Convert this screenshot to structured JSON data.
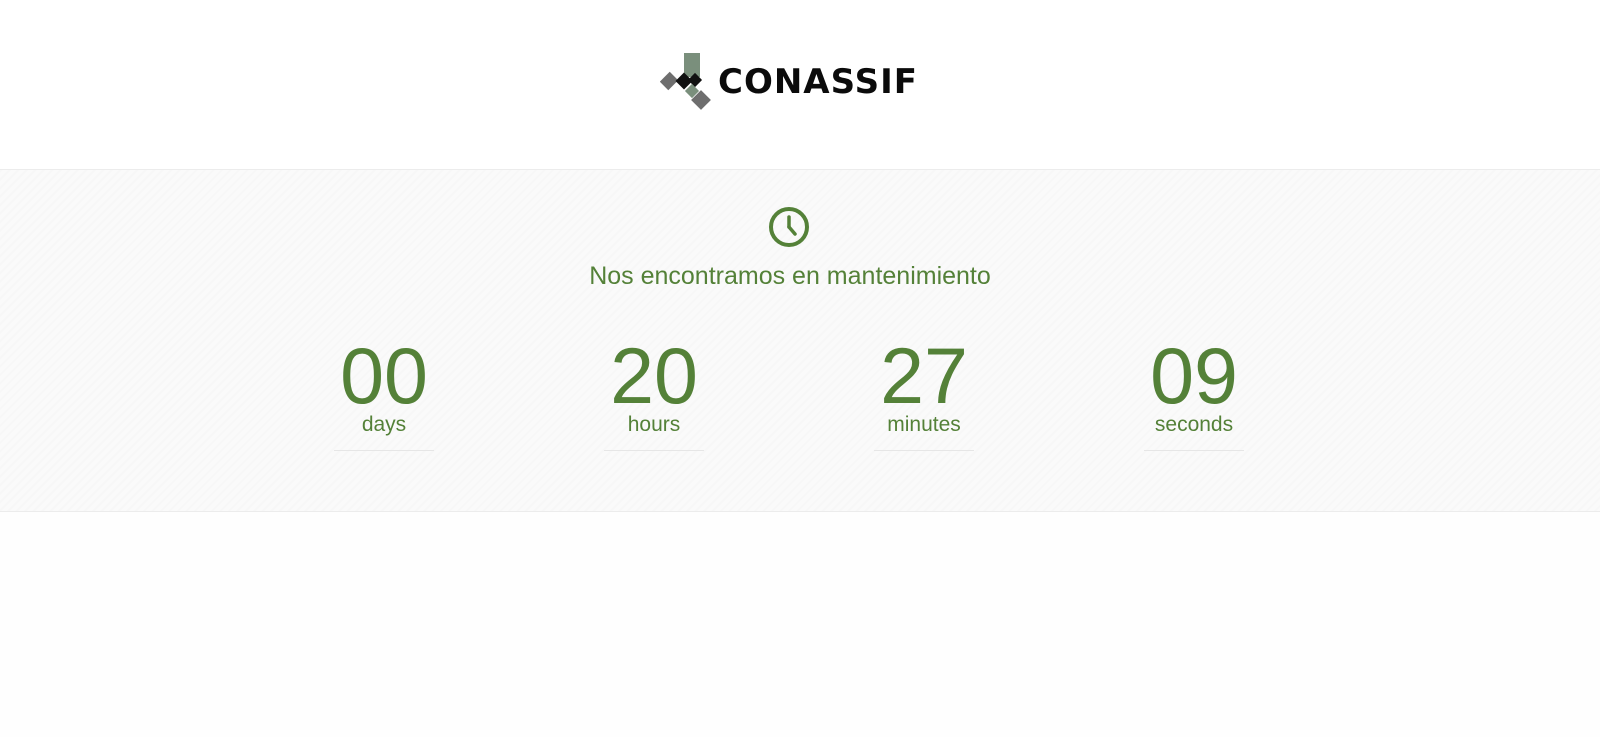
{
  "brand": {
    "name": "CONASSIF"
  },
  "maintenance": {
    "message": "Nos encontramos en mantenimiento",
    "icon": "clock-icon"
  },
  "countdown": [
    {
      "value": "00",
      "label": "days"
    },
    {
      "value": "20",
      "label": "hours"
    },
    {
      "value": "27",
      "label": "minutes"
    },
    {
      "value": "09",
      "label": "seconds"
    }
  ],
  "colors": {
    "accent": "#548138",
    "logo_green": "#7a8f7c",
    "logo_gray": "#6e6e6e",
    "text_dark": "#0b0b0b"
  }
}
